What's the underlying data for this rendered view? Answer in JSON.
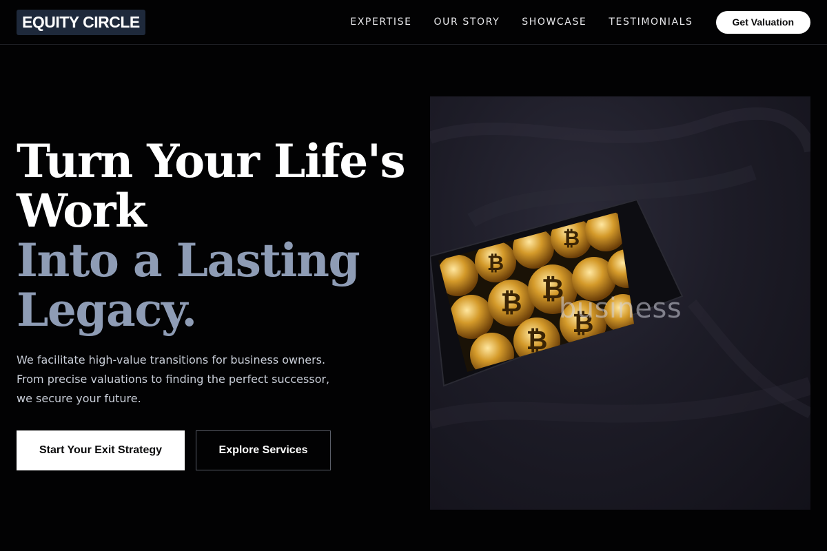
{
  "header": {
    "logo": "EQUITY CIRCLE",
    "nav": [
      "EXPERTISE",
      "OUR STORY",
      "SHOWCASE",
      "TESTIMONIALS"
    ],
    "cta": "Get Valuation"
  },
  "hero": {
    "title_line1": "Turn Your Life's",
    "title_line2": "Work",
    "title_line3": "Into a Lasting",
    "title_line4": "Legacy.",
    "subtitle_line1": "We facilitate high-value transitions for business owners.",
    "subtitle_line2": "From precise valuations to finding the perfect successor,",
    "subtitle_line3": "we secure your future.",
    "primary_button": "Start Your Exit Strategy",
    "secondary_button": "Explore Services"
  },
  "image": {
    "overlay_text": "business",
    "subject": "phone-with-bitcoin-coins-on-dark-fabric"
  },
  "colors": {
    "background": "#020203",
    "title_white": "#ffffff",
    "title_muted": "#8e9cb5",
    "logo_bg": "#1e293b"
  }
}
